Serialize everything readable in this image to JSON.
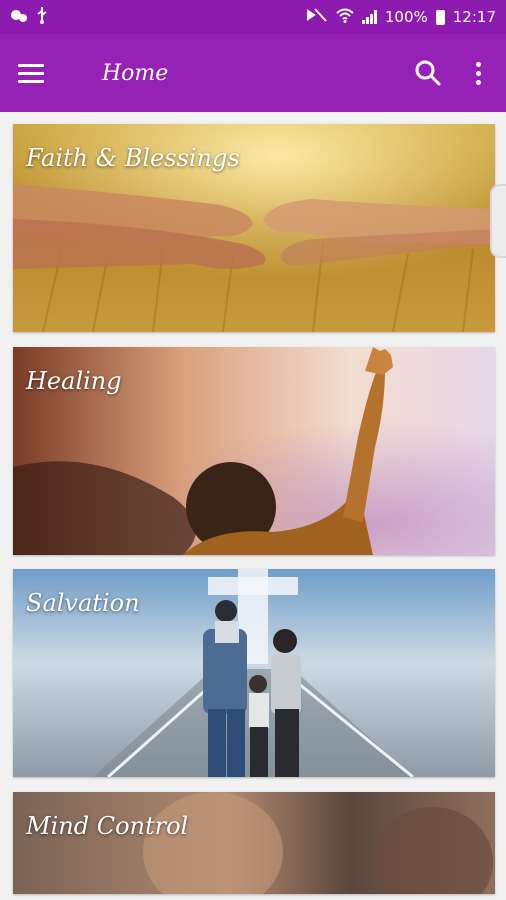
{
  "status_bar": {
    "battery_pct": "100%",
    "time": "12:17"
  },
  "app_bar": {
    "title": "Home"
  },
  "categories": [
    {
      "label": "Faith & Blessings"
    },
    {
      "label": "Healing"
    },
    {
      "label": "Salvation"
    },
    {
      "label": "Mind Control"
    }
  ],
  "colors": {
    "status_bar": "#8d1bb0",
    "app_bar": "#9521b7"
  }
}
